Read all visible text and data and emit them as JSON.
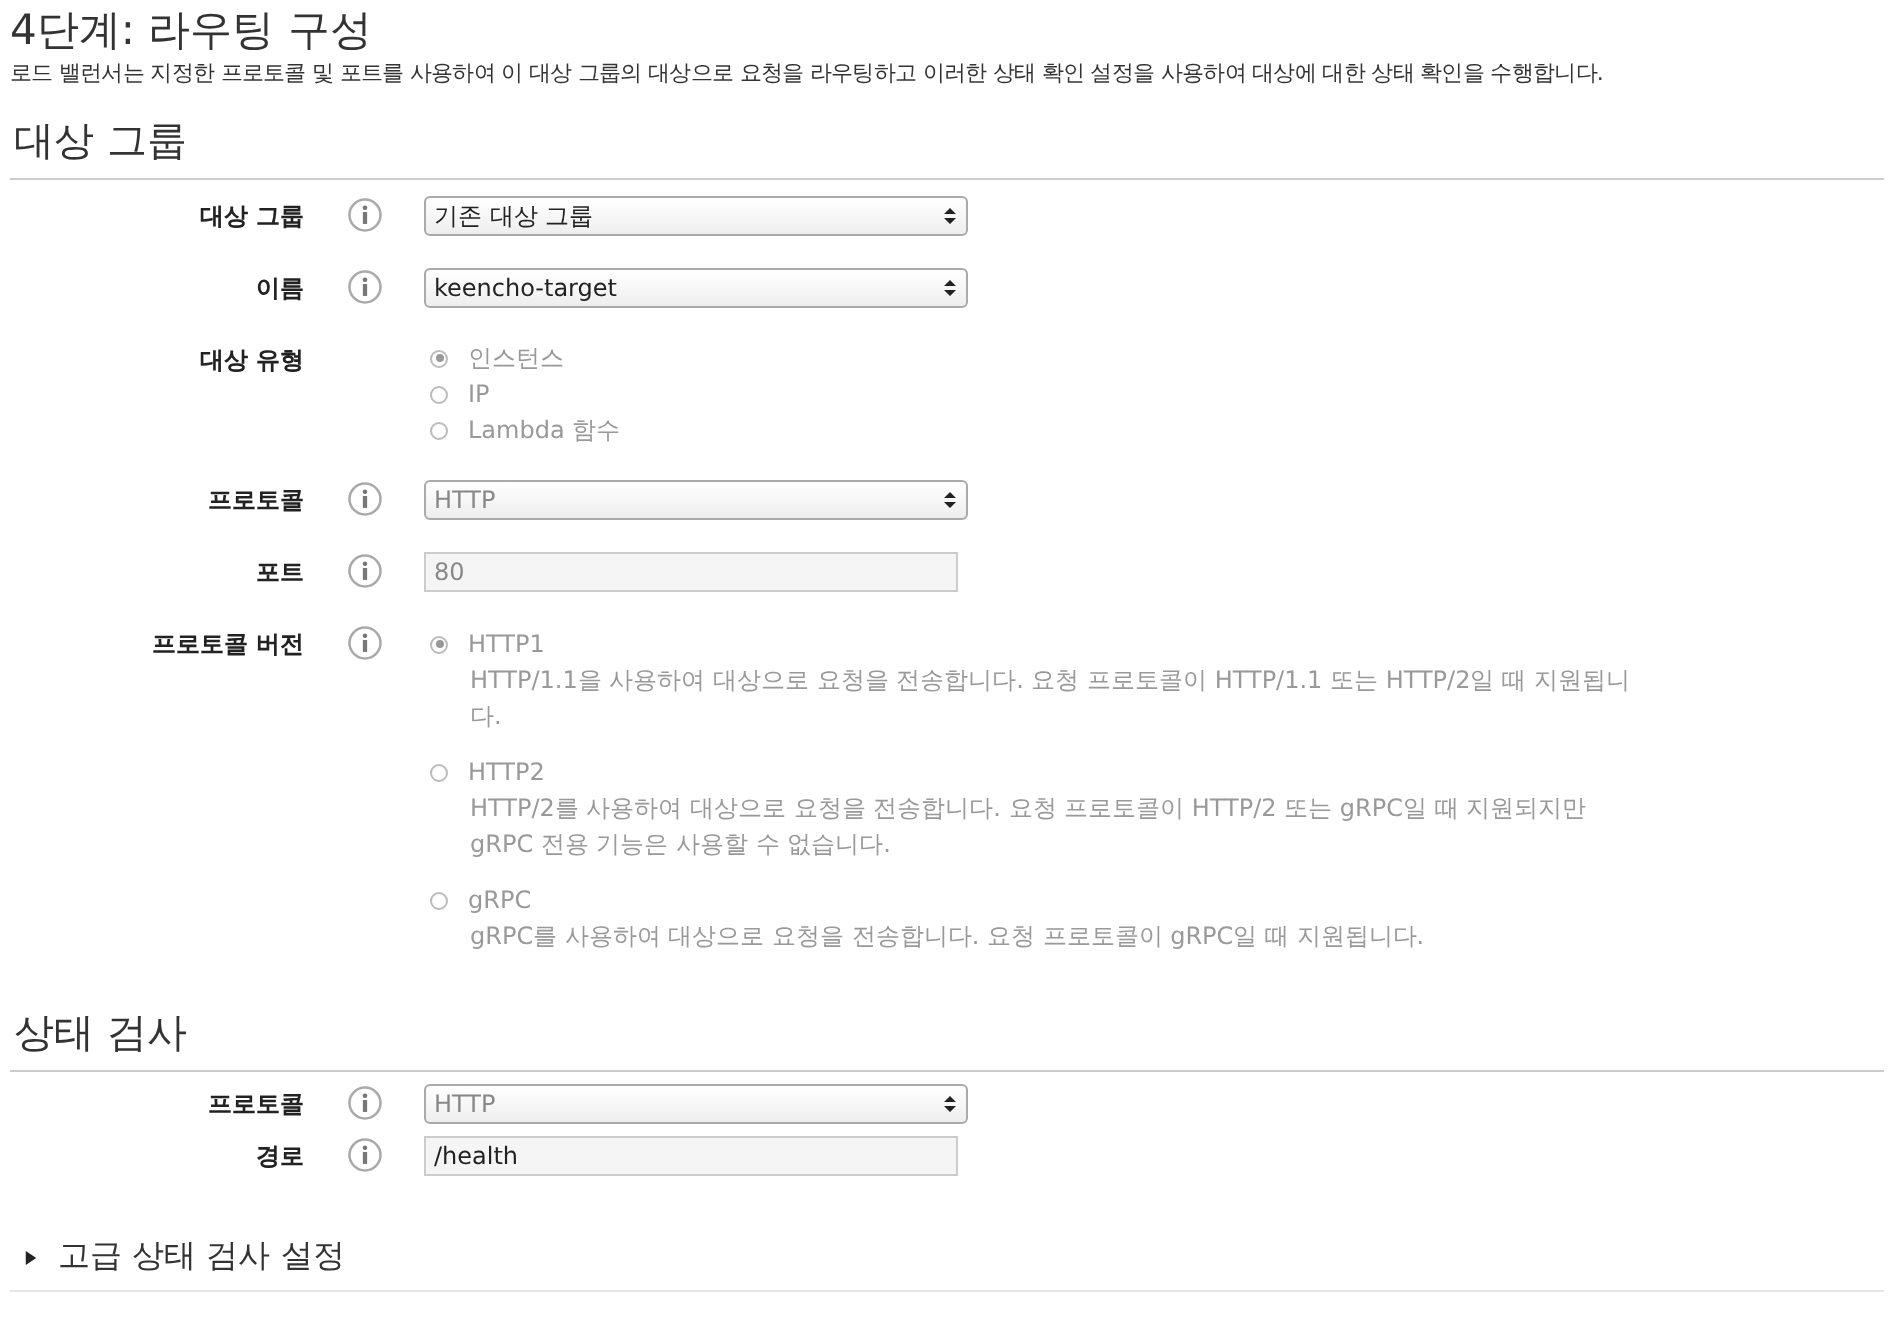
{
  "title": "4단계: 라우팅 구성",
  "intro": "로드 밸런서는 지정한 프로토콜 및 포트를 사용하여 이 대상 그룹의 대상으로 요청을 라우팅하고 이러한 상태 확인 설정을 사용하여 대상에 대한 상태 확인을 수행합니다.",
  "sections": [
    {
      "heading": "대상 그룹",
      "fields": [
        {
          "kind": "select",
          "label": "대상 그룹",
          "info": true,
          "value": "기존 대상 그룹",
          "disabled": false
        },
        {
          "kind": "select",
          "label": "이름",
          "info": true,
          "value": "keencho-target",
          "disabled": false
        },
        {
          "kind": "radio",
          "label": "대상 유형",
          "info": false,
          "disabled": true,
          "options": [
            {
              "label": "인스턴스",
              "selected": true
            },
            {
              "label": "IP",
              "selected": false
            },
            {
              "label": "Lambda 함수",
              "selected": false
            }
          ]
        },
        {
          "kind": "select",
          "label": "프로토콜",
          "info": true,
          "value": "HTTP",
          "disabled": true
        },
        {
          "kind": "input",
          "label": "포트",
          "info": true,
          "value": "80",
          "disabled": true
        },
        {
          "kind": "radio",
          "label": "프로토콜 버전",
          "info": true,
          "disabled": true,
          "options": [
            {
              "label": "HTTP1",
              "description": "HTTP/1.1을 사용하여 대상으로 요청을 전송합니다. 요청 프로토콜이 HTTP/1.1 또는 HTTP/2일 때 지원됩니다.",
              "selected": true
            },
            {
              "label": "HTTP2",
              "description": "HTTP/2를 사용하여 대상으로 요청을 전송합니다. 요청 프로토콜이 HTTP/2 또는 gRPC일 때 지원되지만 gRPC 전용 기능은 사용할 수 없습니다.",
              "selected": false
            },
            {
              "label": "gRPC",
              "description": "gRPC를 사용하여 대상으로 요청을 전송합니다. 요청 프로토콜이 gRPC일 때 지원됩니다.",
              "selected": false
            }
          ]
        }
      ]
    },
    {
      "heading": "상태 검사",
      "fields": [
        {
          "kind": "select",
          "label": "프로토콜",
          "info": true,
          "value": "HTTP",
          "disabled": true
        },
        {
          "kind": "input",
          "label": "경로",
          "info": true,
          "value": "/health",
          "disabled": false
        }
      ]
    }
  ],
  "advanced": {
    "label": "고급 상태 검사 설정",
    "expanded": false
  }
}
